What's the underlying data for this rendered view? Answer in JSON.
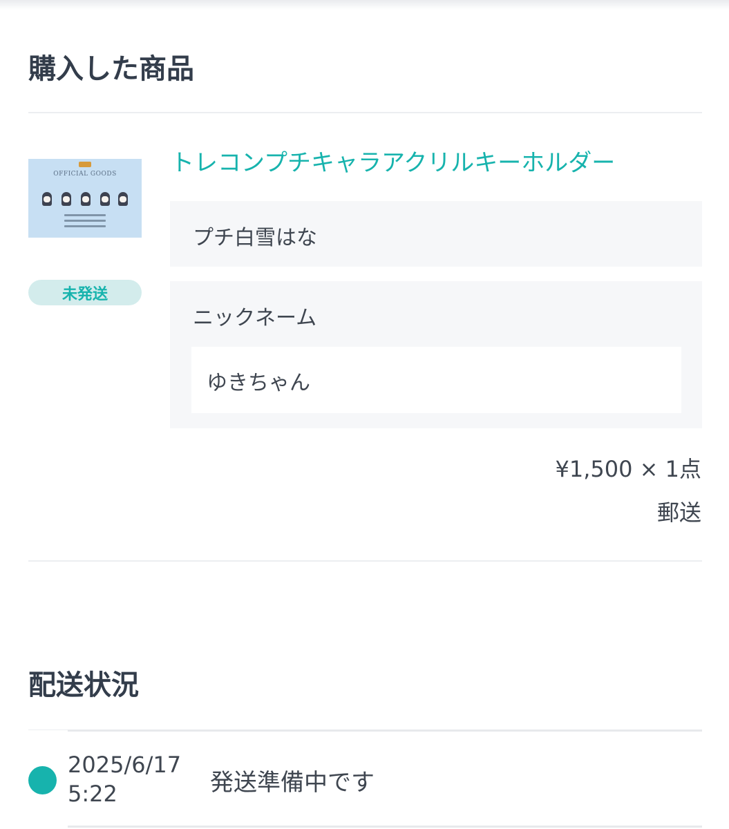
{
  "purchased_section": {
    "title": "購入した商品"
  },
  "product": {
    "thumbnail_text": "OFFICIAL GOODS",
    "status_badge": "未発送",
    "name": "トレコンプチキャラアクリルキーホルダー",
    "variant": "プチ白雪はな",
    "nickname_label": "ニックネーム",
    "nickname_value": "ゆきちゃん",
    "price_line": "¥1,500 × 1点",
    "shipping_method": "郵送"
  },
  "delivery_section": {
    "title": "配送状況",
    "events": [
      {
        "date": "2025/6/17",
        "time": "5:22",
        "status": "発送準備中です"
      }
    ]
  },
  "colors": {
    "accent": "#17b3ad",
    "badge_bg": "#d3ecec",
    "option_bg": "#f6f7f9",
    "text": "#333d4b"
  }
}
